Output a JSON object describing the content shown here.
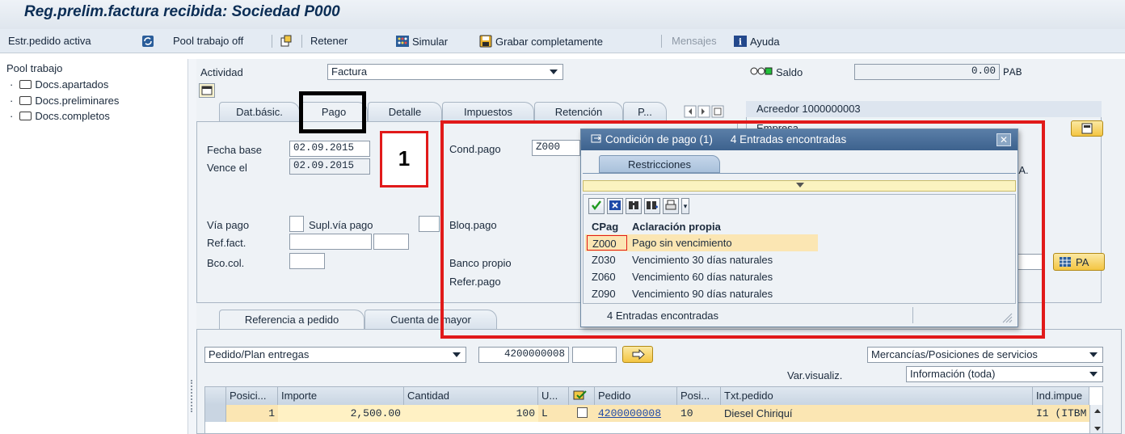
{
  "title": "Reg.prelim.factura recibida: Sociedad P000",
  "toolbar": {
    "estr_pedido": "Estr.pedido activa",
    "pool_trabajo": "Pool trabajo off",
    "retener": "Retener",
    "simular": "Simular",
    "grabar": "Grabar completamente",
    "mensajes": "Mensajes",
    "ayuda": "Ayuda"
  },
  "pool": {
    "header": "Pool trabajo",
    "items": [
      "Docs.apartados",
      "Docs.preliminares",
      "Docs.completos"
    ]
  },
  "header": {
    "actividad_label": "Actividad",
    "actividad_value": "Factura",
    "saldo_label": "Saldo",
    "saldo_value": "0.00",
    "saldo_currency": "PAB"
  },
  "tabs": [
    "Dat.básic.",
    "Pago",
    "Detalle",
    "Impuestos",
    "Retención",
    "P..."
  ],
  "pago": {
    "fecha_base_label": "Fecha base",
    "fecha_base_value": "02.09.2015",
    "vence_label": "Vence el",
    "vence_value": "02.09.2015",
    "via_pago_label": "Vía pago",
    "supl_via_label": "Supl.vía pago",
    "ref_fact_label": "Ref.fact.",
    "bco_col_label": "Bco.col.",
    "cond_pago_label": "Cond.pago",
    "cond_pago_value": "Z000",
    "bloq_pago_label": "Bloq.pago",
    "banco_propio_label": "Banco propio",
    "refer_pago_label": "Refer.pago"
  },
  "acreedor": {
    "title": "Acreedor 1000000003",
    "empresa_label": "Empresa",
    "partial_text": "CA.",
    "pa_button": "PA"
  },
  "annotation": {
    "step_number": "1"
  },
  "popup": {
    "title": "Condición de pago (1)",
    "count_text": "4 Entradas encontradas",
    "tab": "Restricciones",
    "columns": [
      "CPag",
      "Aclaración propia"
    ],
    "rows": [
      {
        "code": "Z000",
        "desc": "Pago sin vencimiento"
      },
      {
        "code": "Z030",
        "desc": "Vencimiento 30 días naturales"
      },
      {
        "code": "Z060",
        "desc": "Vencimiento 60 días naturales"
      },
      {
        "code": "Z090",
        "desc": "Vencimiento 90 días naturales"
      }
    ],
    "footer": "4 Entradas encontradas"
  },
  "lower": {
    "tabs": [
      "Referencia a pedido",
      "Cuenta de mayor"
    ],
    "pedido_type": "Pedido/Plan entregas",
    "pedido_number": "4200000008",
    "mercancias": "Mercancías/Posiciones de servicios",
    "var_visualiz_label": "Var.visualiz.",
    "var_visualiz_value": "Información (toda)",
    "columns": [
      "Posici...",
      "Importe",
      "Cantidad",
      "U...",
      "",
      "Pedido",
      "Posi...",
      "Txt.pedido",
      "Ind.impue"
    ],
    "row": {
      "posicion": "1",
      "importe": "2,500.00",
      "cantidad": "100",
      "unidad": "L",
      "pedido": "4200000008",
      "posi": "10",
      "txt_pedido": "Diesel Chiriquí",
      "ind_impuesto": "I1 (ITBM"
    }
  },
  "colors": {
    "highlight_red": "#e11a1a",
    "row_selected": "#fbe6b3",
    "popup_header": "#3d628e"
  }
}
